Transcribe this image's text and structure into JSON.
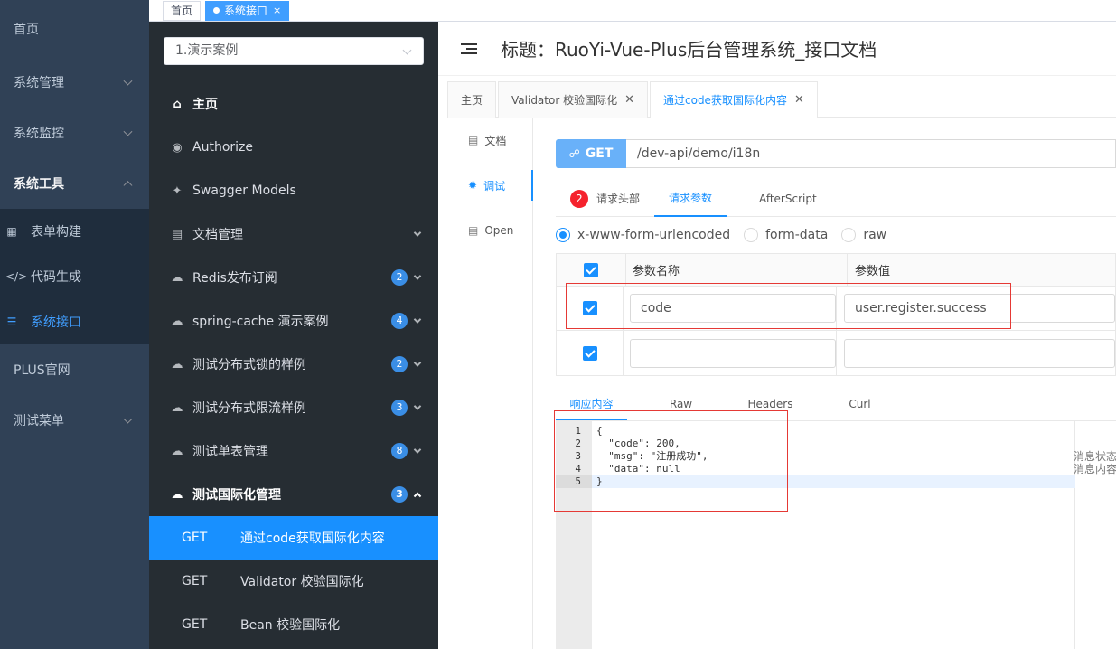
{
  "sidebar": {
    "items": [
      {
        "label": "首页"
      },
      {
        "label": "系统管理"
      },
      {
        "label": "系统监控"
      },
      {
        "label": "系统工具"
      }
    ],
    "sub_items": [
      {
        "label": "表单构建",
        "icon": "grid-icon"
      },
      {
        "label": "代码生成",
        "icon": "code-icon"
      },
      {
        "label": "系统接口",
        "icon": "sliders-icon"
      }
    ],
    "bottom_items": [
      {
        "label": "PLUS官网"
      },
      {
        "label": "测试菜单"
      }
    ]
  },
  "tags": {
    "home": "首页",
    "active": "系统接口",
    "close": "×"
  },
  "docmenu": {
    "group": "1.演示案例",
    "items": [
      {
        "label": "主页",
        "icon": "home-icon"
      },
      {
        "label": "Authorize",
        "icon": "lock-icon"
      },
      {
        "label": "Swagger Models",
        "icon": "cube-icon"
      },
      {
        "label": "文档管理",
        "icon": "doc-icon"
      },
      {
        "label": "Redis发布订阅",
        "badge": "2",
        "icon": "cloud-icon"
      },
      {
        "label": "spring-cache 演示案例",
        "badge": "4",
        "icon": "cloud-icon"
      },
      {
        "label": "测试分布式锁的样例",
        "badge": "2",
        "icon": "cloud-icon"
      },
      {
        "label": "测试分布式限流样例",
        "badge": "3",
        "icon": "cloud-icon"
      },
      {
        "label": "测试单表管理",
        "badge": "8",
        "icon": "cloud-icon"
      },
      {
        "label": "测试国际化管理",
        "badge": "3",
        "icon": "cloud-icon"
      }
    ],
    "apis": [
      {
        "method": "GET",
        "label": "通过code获取国际化内容"
      },
      {
        "method": "GET",
        "label": "Validator 校验国际化"
      },
      {
        "method": "GET",
        "label": "Bean 校验国际化"
      }
    ]
  },
  "content": {
    "title": "标题：RuoYi-Vue-Plus后台管理系统_接口文档",
    "tabs": [
      {
        "label": "主页"
      },
      {
        "label": "Validator 校验国际化"
      },
      {
        "label": "通过code获取国际化内容"
      }
    ],
    "vtabs": [
      {
        "label": "文档",
        "icon": "file-icon"
      },
      {
        "label": "调试",
        "icon": "bug-icon"
      },
      {
        "label": "Open",
        "icon": "doc-icon"
      }
    ],
    "method": "GET",
    "url": "/dev-api/demo/i18n",
    "subtabs": {
      "header_badge": "2",
      "header": "请求头部",
      "params": "请求参数",
      "after": "AfterScript"
    },
    "radios": [
      "x-www-form-urlencoded",
      "form-data",
      "raw"
    ],
    "table": {
      "col_name": "参数名称",
      "col_value": "参数值",
      "rows": [
        {
          "name": "code",
          "value": "user.register.success"
        },
        {
          "name": "",
          "value": ""
        }
      ]
    },
    "resp_tabs": [
      "响应内容",
      "Raw",
      "Headers",
      "Curl"
    ],
    "line_numbers": [
      "1",
      "2",
      "3",
      "4",
      "5"
    ],
    "code_lines": [
      "{",
      "  \"code\": 200,",
      "  \"msg\": \"注册成功\",",
      "  \"data\": null",
      "}"
    ],
    "side_notes": [
      "消息状态",
      "消息内容"
    ]
  }
}
